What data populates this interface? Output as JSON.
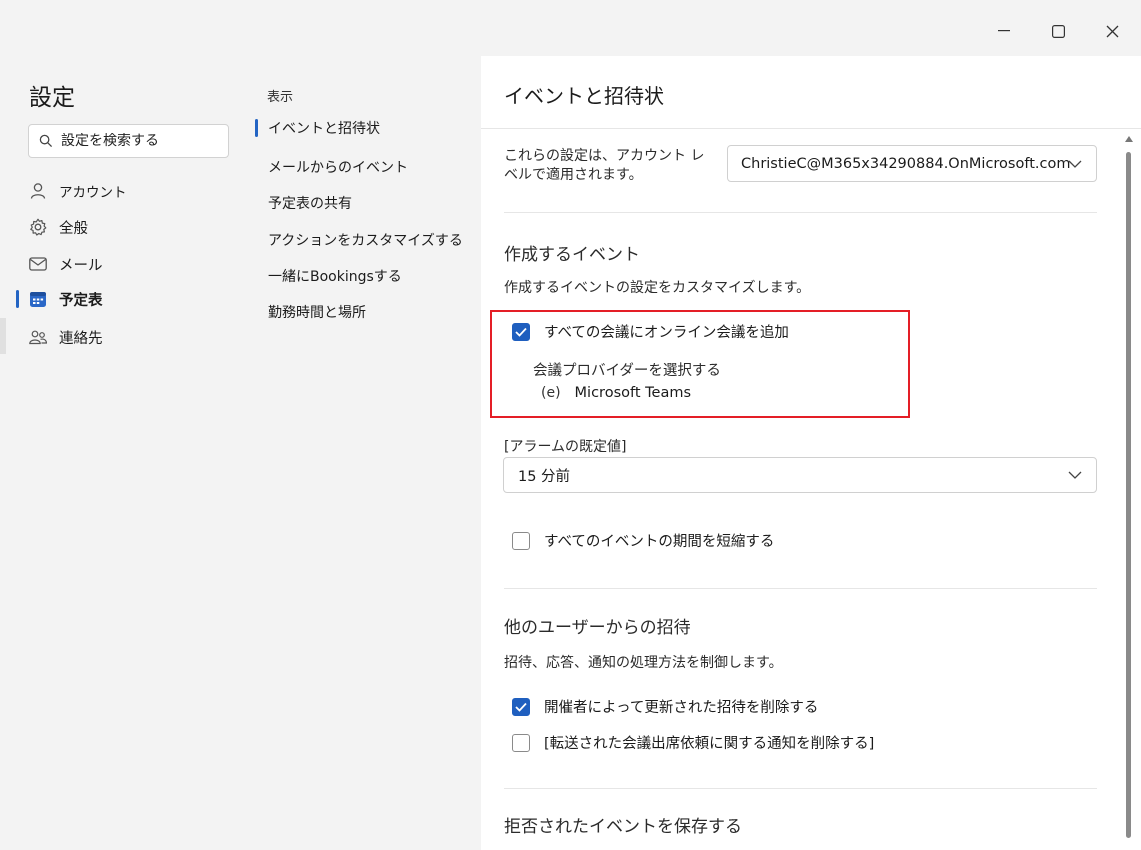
{
  "window": {
    "minimize_glyph": "—",
    "maximize_glyph": "☐",
    "close_glyph": "✕"
  },
  "sidebar": {
    "title": "設定",
    "search": {
      "placeholder": "設定を検索する",
      "icon": "search-icon"
    },
    "items": [
      {
        "label": "アカウント",
        "icon": "person-icon"
      },
      {
        "label": "全般",
        "icon": "gear-icon"
      },
      {
        "label": "メール",
        "icon": "mail-icon"
      },
      {
        "label": "予定表",
        "icon": "calendar-icon",
        "selected": true
      },
      {
        "label": "連絡先",
        "icon": "people-icon"
      }
    ]
  },
  "subnav": {
    "header": "表示",
    "items": [
      {
        "label": "イベントと招待状",
        "selected": true
      },
      {
        "label": "メールからのイベント"
      },
      {
        "label": "予定表の共有"
      },
      {
        "label": "アクションをカスタマイズする"
      },
      {
        "label": "一緒にBookingsする"
      },
      {
        "label": "勤務時間と場所"
      }
    ]
  },
  "main": {
    "title": "イベントと招待状",
    "account_note_line1": "これらの設定は、アカウント レ",
    "account_note_line2": "ベルで適用されます。",
    "account_dropdown": "ChristieC@M365x34290884.OnMicrosoft.com",
    "created_events": {
      "title": "作成するイベント",
      "description": "作成するイベントの設定をカスタマイズします。",
      "add_online_meeting": {
        "label": "すべての会議にオンライン会議を追加",
        "checked": true
      },
      "provider_label": "会議プロバイダーを選択する",
      "provider_icon": "(e)",
      "provider_value": "Microsoft Teams",
      "reminder_label": "[アラームの既定値]",
      "reminder_value": "15 分前",
      "shorten_events": {
        "label": "すべてのイベントの期間を短縮する",
        "checked": false
      }
    },
    "invitations": {
      "title": "他のユーザーからの招待",
      "description": "招待、応答、通知の処理方法を制御します。",
      "delete_updated": {
        "label": "開催者によって更新された招待を削除する",
        "checked": true
      },
      "delete_forwarded": {
        "label": "[転送された会議出席依頼に関する通知を削除する]",
        "checked": false
      }
    },
    "declined": {
      "title": "拒否されたイベントを保存する"
    }
  },
  "colors": {
    "accent": "#1f5fbf",
    "highlight": "#e41e26"
  }
}
